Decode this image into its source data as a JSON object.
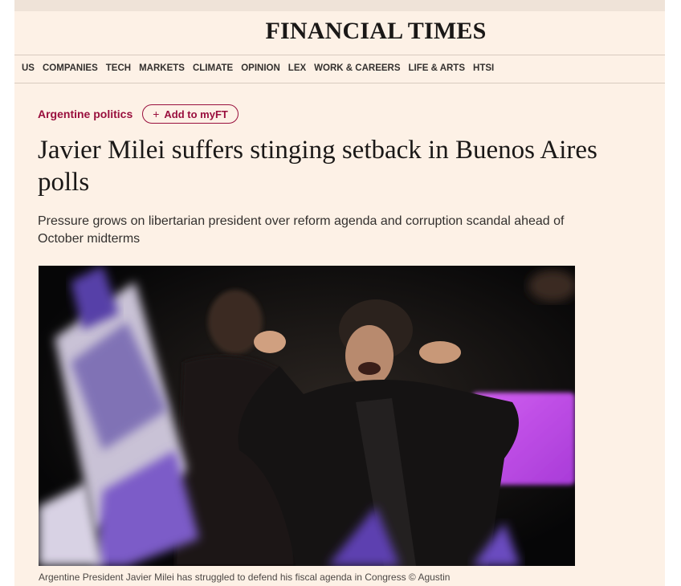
{
  "header": {
    "masthead": "FINANCIAL TIMES"
  },
  "nav": {
    "items": [
      "US",
      "COMPANIES",
      "TECH",
      "MARKETS",
      "CLIMATE",
      "OPINION",
      "LEX",
      "WORK & CAREERS",
      "LIFE & ARTS",
      "HTSI"
    ]
  },
  "article": {
    "topic": "Argentine politics",
    "add_button_label": "Add to myFT",
    "add_button_icon": "plus-icon",
    "headline": "Javier Milei suffers stinging setback in Buenos Aires polls",
    "standfirst": "Pressure grows on libertarian president over reform agenda and corruption scandal ahead of October midterms",
    "caption": "Argentine President Javier Milei has struggled to defend his fiscal agenda in Congress © Agustin"
  },
  "colors": {
    "page_background": "#fdf1e6",
    "topic_claret": "#990f3d",
    "text_dark": "#1a1817"
  }
}
